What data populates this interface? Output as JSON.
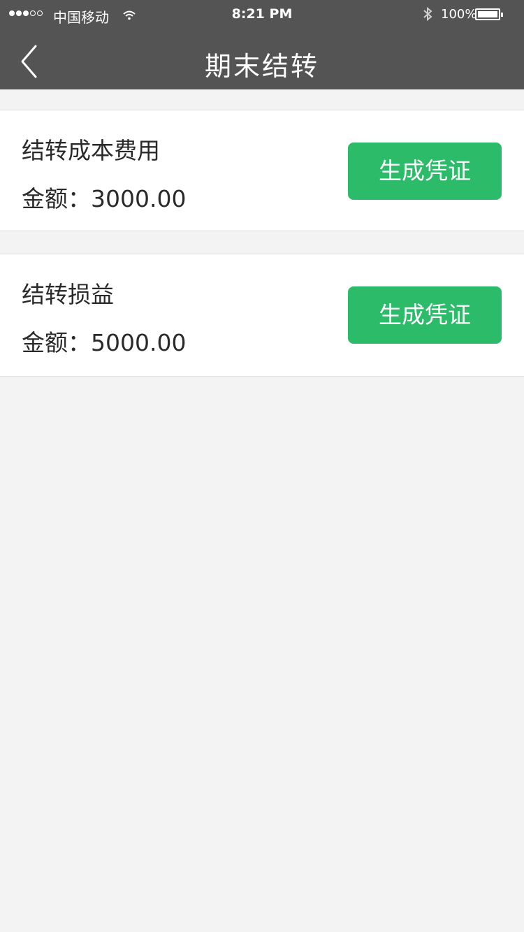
{
  "status_bar": {
    "carrier": "中国移动",
    "time": "8:21 PM",
    "battery_percent": "100%",
    "signal_bars_filled": 3,
    "signal_bars_total": 5
  },
  "header": {
    "title": "期末结转",
    "back_icon": "chevron-left-icon"
  },
  "items": [
    {
      "title": "结转成本费用",
      "amount": "金额：3000.00",
      "button_label": "生成凭证"
    },
    {
      "title": "结转损益",
      "amount": "金额：5000.00",
      "button_label": "生成凭证"
    }
  ],
  "colors": {
    "header_bg": "#545454",
    "page_bg": "#f3f3f3",
    "button_bg": "#2bbb69"
  }
}
